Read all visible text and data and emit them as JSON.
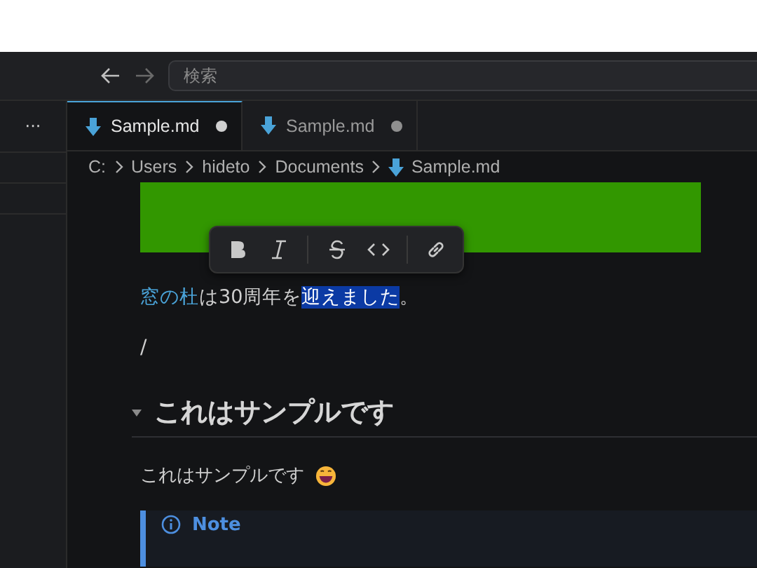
{
  "titlebar": {
    "search": {
      "placeholder": "検索"
    }
  },
  "sidebar": {
    "more": "···"
  },
  "tabs": [
    {
      "label": "Sample.md",
      "selected": true,
      "modified": true
    },
    {
      "label": "Sample.md",
      "selected": false,
      "modified": true
    }
  ],
  "breadcrumb": [
    "C:",
    "Users",
    "hideto",
    "Documents",
    "Sample.md"
  ],
  "format_toolbar": [
    {
      "kind": "bold"
    },
    {
      "kind": "italic"
    },
    {
      "kind": "strikethrough"
    },
    {
      "kind": "code"
    },
    {
      "kind": "link"
    }
  ],
  "content": {
    "paragraph": [
      {
        "text": "窓の杜",
        "kind": "link"
      },
      {
        "text": "は30周年を",
        "kind": "plain"
      },
      {
        "text": "迎えました",
        "kind": "selected"
      },
      {
        "text": "。",
        "kind": "plain"
      }
    ],
    "slash": "/",
    "heading": {
      "text": "これはサンプルです",
      "expanded": true
    },
    "body": "これはサンプルです",
    "callout": {
      "title": "Note"
    }
  }
}
